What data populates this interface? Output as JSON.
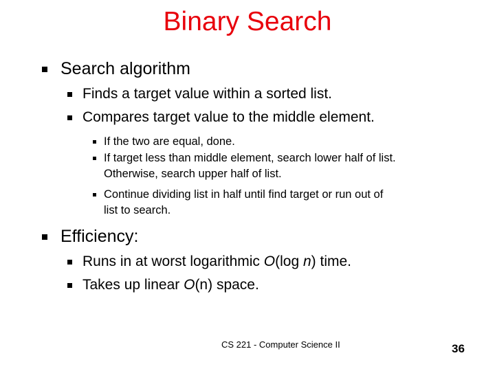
{
  "slide": {
    "title": "Binary Search",
    "sections": [
      {
        "label": "Search algorithm",
        "items": [
          {
            "label": "Finds a target value within a sorted list."
          },
          {
            "label": "Compares target value to the middle element."
          }
        ],
        "subitems": [
          {
            "line1": "If the two are equal, done."
          },
          {
            "line1": "If target less than middle element, search lower half of list.",
            "line2": "Otherwise, search upper half of list."
          },
          {
            "line1": "Continue dividing list in half until find target or run out of",
            "line2": "list to search."
          }
        ]
      },
      {
        "label": "Efficiency:",
        "items": [
          {
            "pre": "Runs in at worst logarithmic ",
            "o": "O",
            "mid": "(log ",
            "n": "n",
            "post": ") time."
          },
          {
            "pre": "Takes up linear ",
            "o": "O",
            "post": "(n) space."
          }
        ]
      }
    ],
    "footer": "CS 221 - Computer Science II",
    "page_number": "36",
    "colors": {
      "title": "#e8000b",
      "text": "#000000",
      "background": "#ffffff"
    }
  }
}
